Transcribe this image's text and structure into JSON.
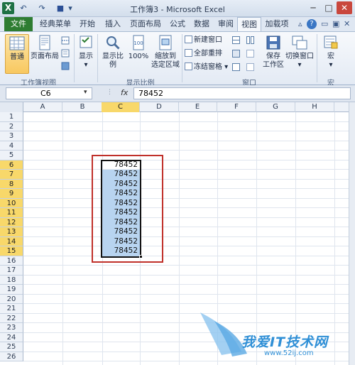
{
  "window": {
    "title": "工作簿3 - Microsoft Excel",
    "app_icon": "X",
    "qa_undo": "↶",
    "qa_redo": "↷",
    "qa_save": "■",
    "qa_more": "▾",
    "min": "─",
    "max": "□",
    "close": "✕"
  },
  "tabs": {
    "file": "文件",
    "items": [
      "经典菜单",
      "开始",
      "插入",
      "页面布局",
      "公式",
      "数据",
      "审阅",
      "视图",
      "加载项"
    ],
    "help": "?"
  },
  "ribbon": {
    "workbook_views": {
      "label": "工作簿视图",
      "normal": "普通",
      "page_layout": "页面布局"
    },
    "show": {
      "label": "显示"
    },
    "zoom": {
      "label": "显示比例",
      "zoom": "显示比例",
      "zoom100": "100%",
      "zoom_selection_1": "缩放到",
      "zoom_selection_2": "选定区域"
    },
    "window": {
      "label": "窗口",
      "new_window": "新建窗口",
      "arrange_all": "全部重排",
      "freeze_panes": "冻结窗格",
      "save_ws_1": "保存",
      "save_ws_2": "工作区",
      "switch_windows": "切换窗口"
    },
    "macros": {
      "label": "宏",
      "macros": "宏"
    }
  },
  "formula_bar": {
    "name_box": "C6",
    "fx": "fx",
    "value": "78452"
  },
  "columns": [
    "A",
    "B",
    "C",
    "D",
    "E",
    "F",
    "G",
    "H"
  ],
  "rows": [
    "1",
    "2",
    "3",
    "4",
    "5",
    "6",
    "7",
    "8",
    "9",
    "10",
    "11",
    "12",
    "13",
    "14",
    "15",
    "16",
    "17",
    "18",
    "19",
    "20",
    "21",
    "22",
    "23",
    "24",
    "25",
    "26"
  ],
  "cells": {
    "C6": "78452",
    "C7": "78452",
    "C8": "78452",
    "C9": "78452",
    "C10": "78452",
    "C11": "78452",
    "C12": "78452",
    "C13": "78452",
    "C14": "78452",
    "C15": "78452"
  },
  "watermark": {
    "text": "我爱IT技术网",
    "url": "www.52ij.com"
  },
  "colors": {
    "file_tab": "#2e7d32",
    "selection_fill": "#b8d4f0",
    "header_selected": "#f8d86a",
    "annotation": "#c0302a"
  }
}
